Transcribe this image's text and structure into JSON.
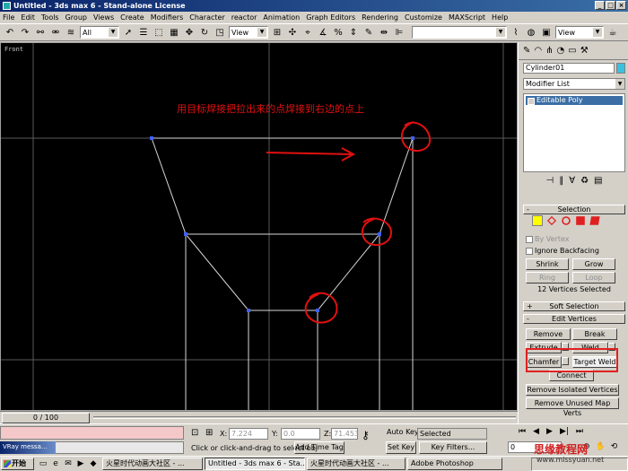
{
  "window": {
    "title": "Untitled - 3ds max 6 - Stand-alone License",
    "min": "_",
    "max": "□",
    "close": "×"
  },
  "menu": [
    "File",
    "Edit",
    "Tools",
    "Group",
    "Views",
    "Create",
    "Modifiers",
    "Character",
    "reactor",
    "Animation",
    "Graph Editors",
    "Rendering",
    "Customize",
    "MAXScript",
    "Help"
  ],
  "toolbar": {
    "selection_filter": "All",
    "ref_coord": "View",
    "ref_coord2": "View"
  },
  "viewport": {
    "label": "Front",
    "annotation": "用目标焊接把拉出来的点焊接到右边的点上"
  },
  "timeslider": {
    "position": "0 / 100"
  },
  "panel": {
    "object_name": "Cylinder01",
    "object_color": "#3cc0e0",
    "modifier_list": "Modifier List",
    "stack_item": "Editable Poly",
    "selection_title": "Selection",
    "by_vertex": "By Vertex",
    "ignore_backfacing": "Ignore Backfacing",
    "shrink": "Shrink",
    "grow": "Grow",
    "ring": "Ring",
    "loop": "Loop",
    "vertex_count": "12 Vertices Selected",
    "soft_selection": "Soft Selection",
    "edit_vertices": "Edit Vertices",
    "remove": "Remove",
    "break": "Break",
    "extrude": "Extrude",
    "weld": "Weld",
    "chamfer": "Chamfer",
    "target_weld": "Target Weld",
    "connect": "Connect",
    "remove_isolated": "Remove Isolated Vertices",
    "remove_unused": "Remove Unused Map Verts"
  },
  "status": {
    "x_label": "X:",
    "x_value": "7.224",
    "y_label": "Y:",
    "y_value": "0.0",
    "z_label": "Z:",
    "z_value": "71.453",
    "prompt": "Click or click-and-drag to select obj",
    "add_time_tag": "Add Time Tag",
    "auto_key": "Auto Key",
    "auto_key_value": "Selected",
    "set_key": "Set Key",
    "key_filters": "Key Filters...",
    "frame": "0",
    "vray_message": "VRay messa..."
  },
  "taskbar": {
    "start": "开始",
    "tasks": [
      "火星时代动画大社区 - ...",
      "Untitled - 3ds max 6 - Sta...",
      "火星时代动画大社区 - ...",
      "Adobe Photoshop"
    ]
  },
  "watermark": {
    "cn": "思缘教程网",
    "url": "www.missyuan.net"
  }
}
